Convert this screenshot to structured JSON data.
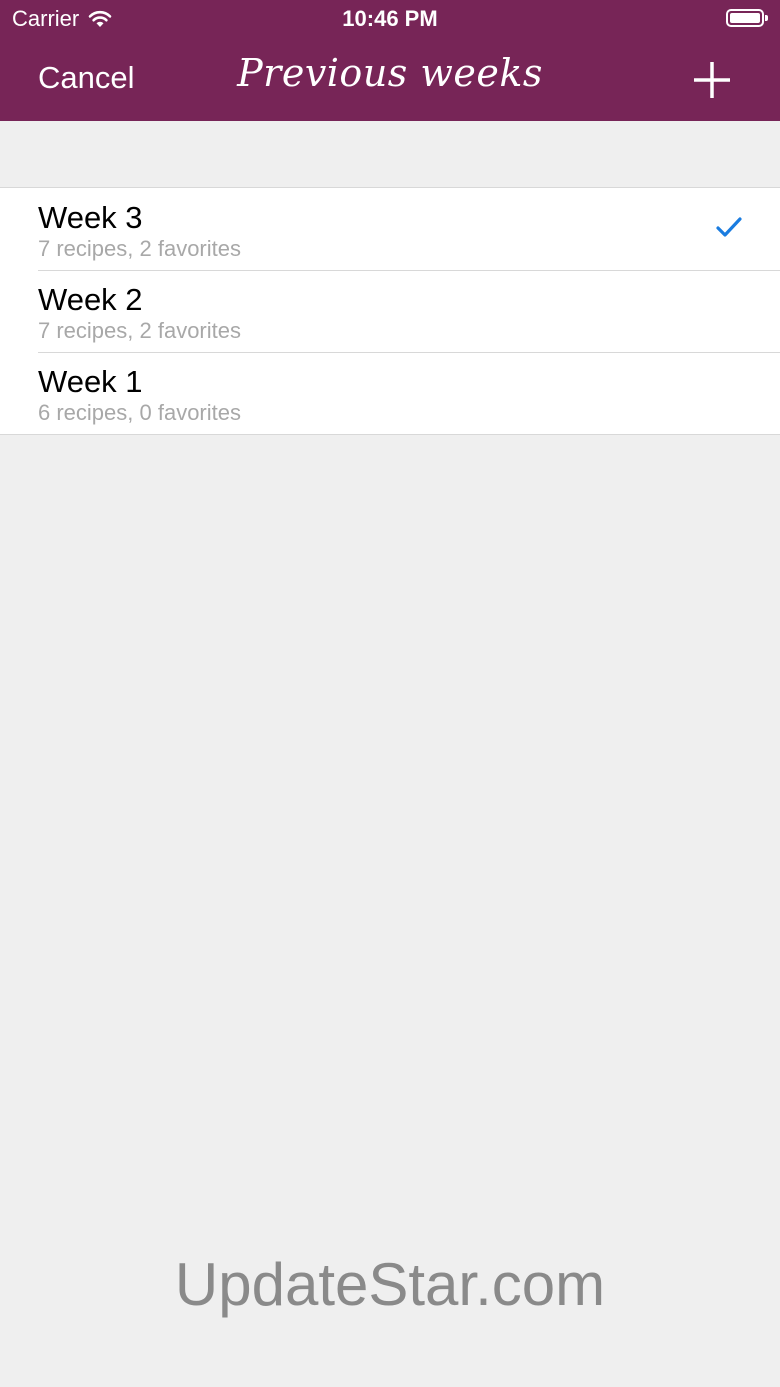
{
  "status_bar": {
    "carrier": "Carrier",
    "time": "10:46 PM"
  },
  "nav": {
    "cancel_label": "Cancel",
    "title": "Previous weeks"
  },
  "weeks": [
    {
      "title": "Week 3",
      "subtitle": "7 recipes, 2 favorites",
      "selected": true
    },
    {
      "title": "Week 2",
      "subtitle": "7 recipes, 2 favorites",
      "selected": false
    },
    {
      "title": "Week 1",
      "subtitle": "6 recipes, 0 favorites",
      "selected": false
    }
  ],
  "watermark": "UpdateStar.com",
  "colors": {
    "nav_background": "#772557",
    "checkmark": "#1a7ce0",
    "page_background": "#efefef"
  },
  "icons": {
    "wifi": "wifi-icon",
    "battery": "battery-icon",
    "add": "plus-icon",
    "selected": "checkmark-icon"
  }
}
